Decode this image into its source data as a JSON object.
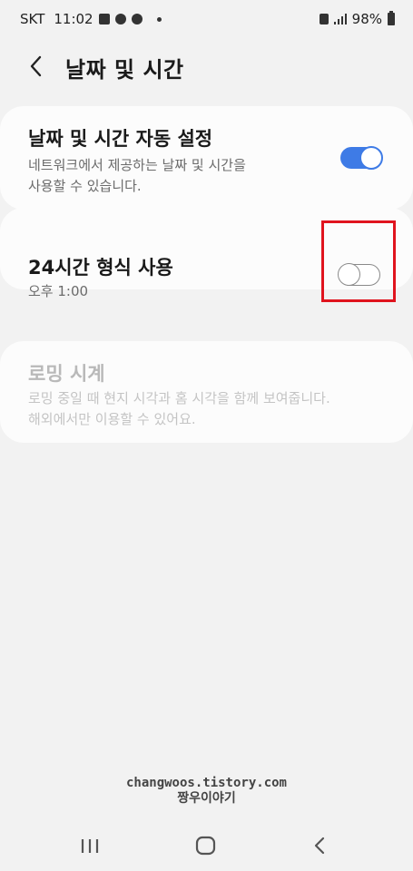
{
  "status_bar": {
    "carrier": "SKT",
    "time": "11:02",
    "battery": "98%"
  },
  "header": {
    "title": "날짜 및 시간"
  },
  "settings": [
    {
      "title": "날짜 및 시간 자동 설정",
      "subtitle": "네트워크에서 제공하는 날짜 및 시간을\n사용할 수 있습니다.",
      "toggle_on": true
    },
    {
      "title": "24시간 형식 사용",
      "subtitle": "오후 1:00",
      "toggle_on": false
    },
    {
      "title": "로밍 시계",
      "subtitle": "로밍 중일 때 현지 시각과 홈 시각을 함께 보여줍니다.\n해외에서만 이용할 수 있어요.",
      "disabled": true
    }
  ],
  "watermark": {
    "line1": "changwoos.tistory.com",
    "line2": "짱우이야기"
  },
  "colors": {
    "accent": "#3e7be6",
    "highlight": "#e0141e",
    "background": "#f2f2f2"
  },
  "icons": {
    "back": "chevron-left-icon",
    "nav_recents": "recent-apps-icon",
    "nav_home": "home-icon",
    "nav_back": "back-icon"
  }
}
